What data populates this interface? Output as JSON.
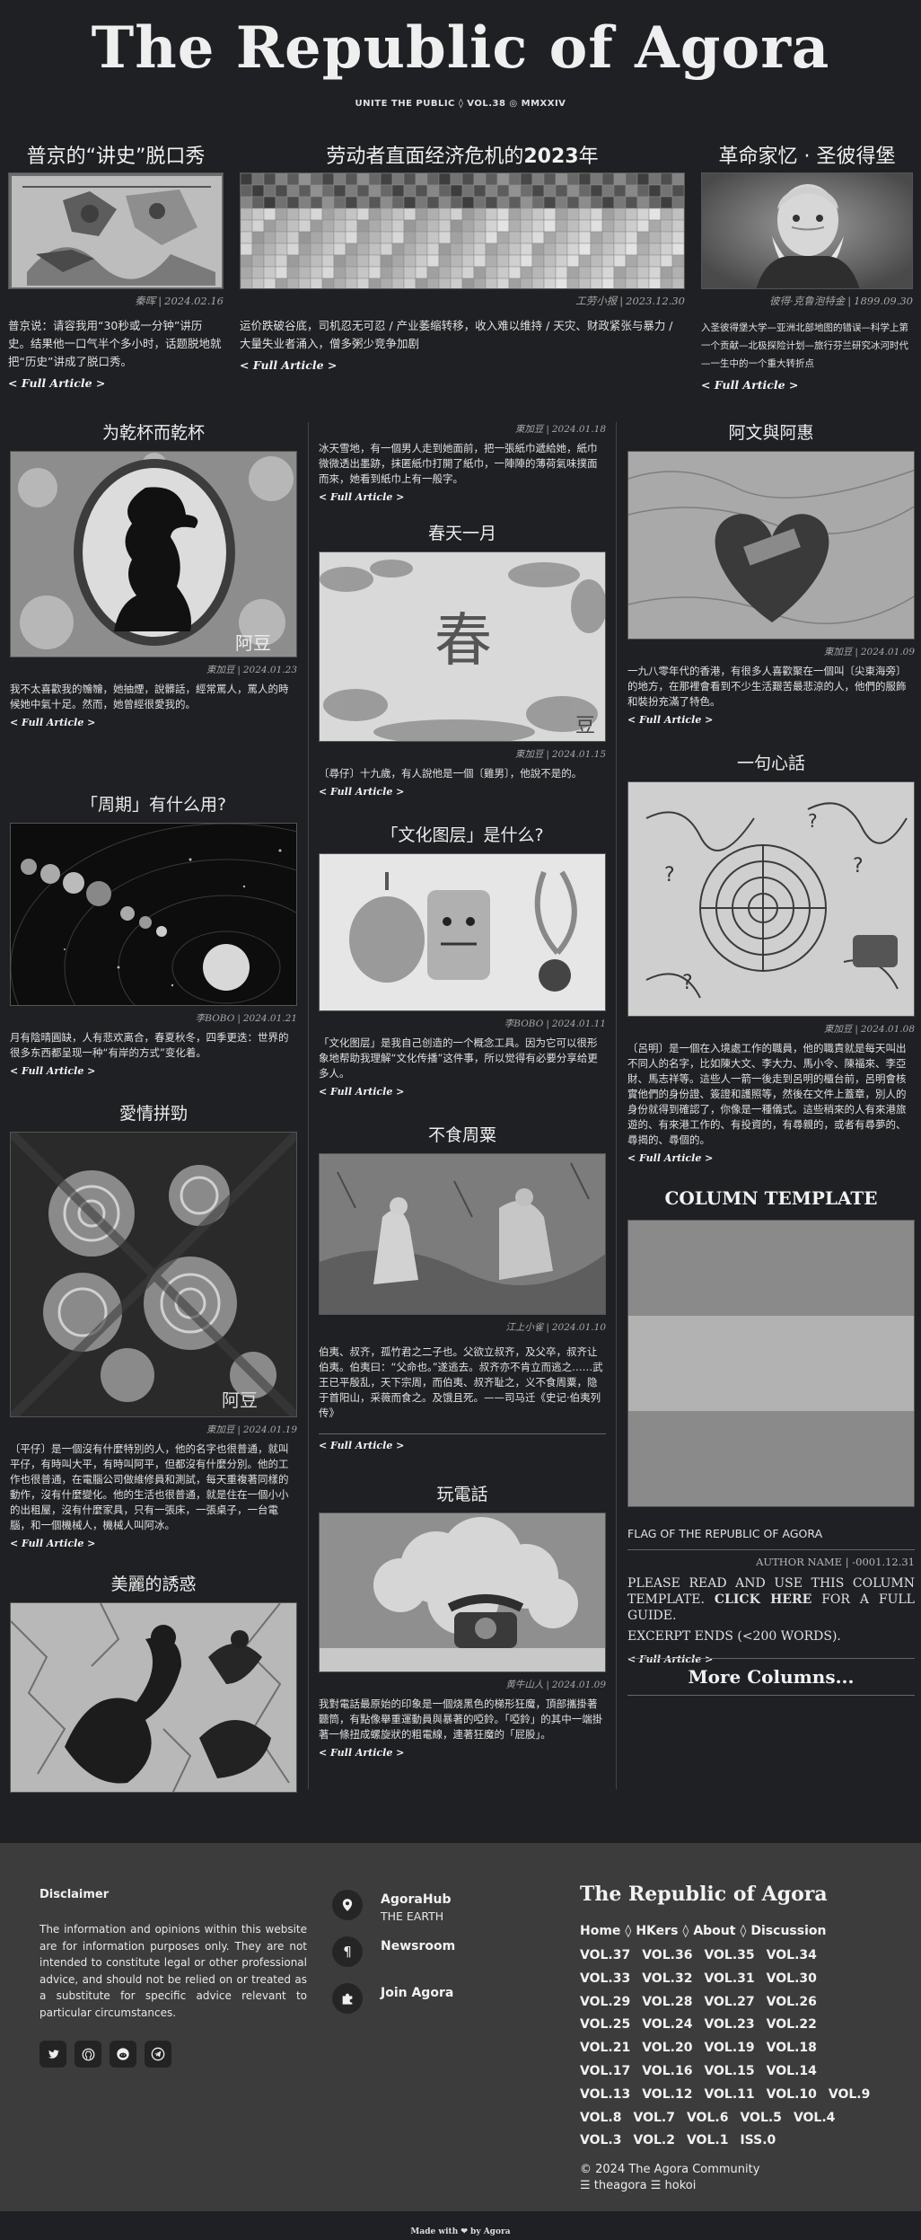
{
  "masthead": {
    "title": "The Republic of Agora",
    "subline": "UNITE THE PUBLIC ◊ VOL.38 ◎ MMXXIV"
  },
  "features": [
    {
      "title": "普京的“讲史”脱口秀",
      "author": "秦晖",
      "date": "2024.02.16",
      "excerpt": "普京说：请容我用“30秒或一分钟”讲历史。结果他一口气半个多小时，话题脱地就把“历史”讲成了脱口秀。",
      "more": "< Full Article >"
    },
    {
      "title_main": "劳动者直面经济危机的",
      "title_year": "2023",
      "title_tail": "年",
      "author": "工劳小报",
      "date": "2023.12.30",
      "excerpt": "运价跌破谷底，司机忍无可忍 / 产业萎缩转移，收入难以维持 / 天灾、财政紧张与暴力 / 大量失业者涌入，僧多粥少竞争加剧",
      "more": "< Full Article >"
    },
    {
      "title": "革命家忆 · 圣彼得堡",
      "author": "彼得·克鲁泡特金",
      "date": "1899.09.30",
      "excerpt": "入圣彼得堡大学—亚洲北部地图的错误—科学上第一个贡献—北极探险计划—旅行芬兰研究冰河时代—一生中的一个重大转折点",
      "more": "< Full Article >"
    }
  ],
  "col1": [
    {
      "title": "为乾杯而乾杯",
      "author": "東加豆",
      "date": "2024.01.23",
      "excerpt": "我不太喜歡我的𣍐𣍐，她抽煙，說髒話，經常罵人，罵人的時候她中氣十足。然而，她曾經很愛我的。",
      "more": "< Full Article >"
    },
    {
      "title": "「周期」有什么用?",
      "author": "李BOBO",
      "date": "2024.01.21",
      "excerpt": "月有陰晴圓缺，人有悲欢离合，春夏秋冬，四季更迭：世界的很多东西都呈现一种“有岸的方式”变化着。",
      "more": "< Full Article >"
    },
    {
      "title": "愛情拼勁",
      "author": "東加豆",
      "date": "2024.01.19",
      "excerpt": "〔平仔〕是一個沒有什麼特別的人，他的名字也很普通，就叫平仔，有時叫大平，有時叫阿平，但都沒有什麼分別。他的工作也很普通，在電腦公司做維修員和測試，每天重複著同樣的動作，沒有什麼變化。他的生活也很普通，就是住在一個小小的出租屋，沒有什麼家具，只有一張床，一張桌子，一台電腦，和一個機械人，機械人叫阿冰。",
      "more": "< Full Article >"
    },
    {
      "title": "美麗的誘惑"
    }
  ],
  "col2": [
    {
      "author": "東加豆",
      "date": "2024.01.18",
      "excerpt": "冰天雪地，有一個男人走到她面前，把一張紙巾遞給她，紙巾微微透出墨跡，抹匿紙巾打開了紙巾，一陣陣的薄荷氣味撲面而來，她看到紙巾上有一般字。",
      "more": "< Full Article >"
    },
    {
      "title": "春天一月",
      "author": "東加豆",
      "date": "2024.01.15",
      "excerpt": "〔尋仔〕十九歲，有人說他是一個〔雞男〕，他說不是的。",
      "more": "< Full Article >"
    },
    {
      "title": "「文化图层」是什么?",
      "author": "李BOBO",
      "date": "2024.01.11",
      "excerpt": "「文化图层」是我自己创造的一个概念工具。因为它可以很形象地帮助我理解“文化传播”这件事，所以觉得有必要分享给更多人。",
      "more": "< Full Article >"
    },
    {
      "title": "不食周粟",
      "author": "江上小雀",
      "date": "2024.01.10",
      "excerpt": "伯夷、叔齐，孤竹君之二子也。父欲立叔齐，及父卒，叔齐让伯夷。伯夷曰：“父命也。”遂逃去。叔齐亦不肯立而逃之……武王已平殷乱，天下宗周，而伯夷、叔齐耻之，义不食周粟，隐于首阳山，采薇而食之。及饿且死。——司马迁《史记·伯夷列传》",
      "more": "< Full Article >"
    },
    {
      "title": "玩電話",
      "author": "黄牛山人",
      "date": "2024.01.09",
      "excerpt": "我對電話最原始的印象是一個烧黑色的梯形狂魔，頂部攜掛著聽筒，有點像舉重運動員與暴著的啞鈴。「啞鈴」的其中一端掛著一條扭成螺旋狀的粗電線，連著狂魔的「屁股」。",
      "more": "< Full Article >"
    }
  ],
  "col3": [
    {
      "title": "阿文與阿惠",
      "author": "東加豆",
      "date": "2024.01.09",
      "excerpt": "一九八零年代的香港，有很多人喜歡聚在一個叫〔尖東海旁〕的地方，在那裡會看到不少生活艱苦最悲涼的人，他們的服飾和裝扮充滿了特色。",
      "more": "< Full Article >"
    },
    {
      "title": "一句心話",
      "author": "東加豆",
      "date": "2024.01.08",
      "excerpt": "〔呂明〕是一個在入境處工作的職員，他的職責就是每天叫出不同人的名字，比如陳大文、李大力、馬小令、陳福來、李亞財、馬志祥等。這些人一箭一後走到呂明的櫃台前，呂明會核實他們的身份證、簽證和護照等，然後在文件上蓋章，別人的身份就得到確認了，你像是一種儀式。這些稍來的人有來港旅遊的、有來港工作的、有投資的，有尋親的，或者有尋夢的、尋揭的、尋個的。",
      "more": "< Full Article >"
    },
    {
      "tmpl_title": "COLUMN TEMPLATE",
      "flag": "FLAG OF THE REPUBLIC OF AGORA",
      "author": "AUTHOR NAME",
      "date": "-0001.12.31",
      "text_a": "PLEASE READ AND USE THIS COLUMN TEMPLATE. ",
      "text_b": "CLICK HERE",
      "text_c": " FOR A FULL GUIDE.",
      "text_d": "EXCERPT ENDS (<200 WORDS).",
      "more": "< Full Article >"
    },
    {
      "more_columns": "More Columns..."
    }
  ],
  "footer": {
    "disclaimer_title": "Disclaimer",
    "disclaimer_text": "The information and opinions within this website are for information purposes only. They are not intended to constitute legal or other professional advice, and should not be relied on or treated as a substitute for specific advice relevant to particular circumstances.",
    "links": [
      {
        "title": "AgoraHub",
        "sub": "THE EARTH",
        "icon": "location-pin-icon"
      },
      {
        "title": "Newsroom",
        "sub": "",
        "icon": "paragraph-icon"
      },
      {
        "title": "Join Agora",
        "sub": "",
        "icon": "puzzle-icon"
      }
    ],
    "brand": "The Republic of Agora",
    "nav": [
      "Home",
      "HKers",
      "About",
      "Discussion"
    ],
    "vols": [
      "VOL.37",
      "VOL.36",
      "VOL.35",
      "VOL.34",
      "VOL.33",
      "VOL.32",
      "VOL.31",
      "VOL.30",
      "VOL.29",
      "VOL.28",
      "VOL.27",
      "VOL.26",
      "VOL.25",
      "VOL.24",
      "VOL.23",
      "VOL.22",
      "VOL.21",
      "VOL.20",
      "VOL.19",
      "VOL.18",
      "VOL.17",
      "VOL.16",
      "VOL.15",
      "VOL.14",
      "VOL.13",
      "VOL.12",
      "VOL.11",
      "VOL.10",
      "VOL.9",
      "VOL.8",
      "VOL.7",
      "VOL.6",
      "VOL.5",
      "VOL.4",
      "VOL.3",
      "VOL.2",
      "VOL.1",
      "ISS.0"
    ],
    "copyright": "© 2024 The Agora Community",
    "handles": "☰ theagora ☰ hokoi",
    "made_with": "Made with ❤ by Agora"
  }
}
